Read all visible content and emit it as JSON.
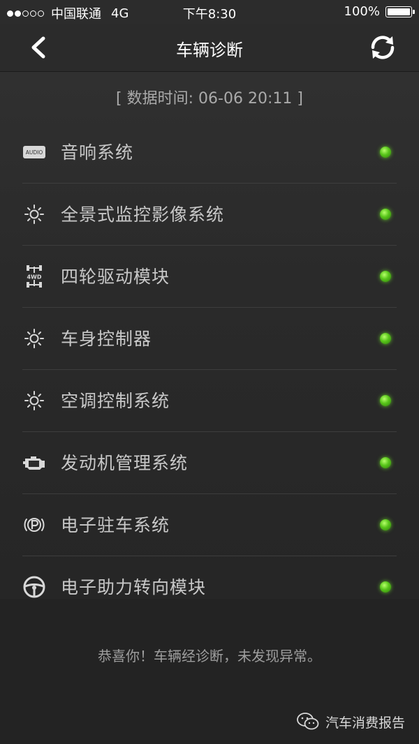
{
  "status_bar": {
    "carrier": "中国联通",
    "network": "4G",
    "time": "下午8:30",
    "battery": "100%",
    "battery_level": 1.0
  },
  "nav": {
    "title": "车辆诊断",
    "back_icon": "chevron-left-icon",
    "refresh_icon": "refresh-icon"
  },
  "data_time": "[ 数据时间: 06-06 20:11 ]",
  "systems": [
    {
      "label": "音响系统",
      "icon": "audio-icon",
      "status_color": "#58c51a"
    },
    {
      "label": "全景式监控影像系统",
      "icon": "sun-icon",
      "status_color": "#58c51a"
    },
    {
      "label": "四轮驱动模块",
      "icon": "4wd-icon",
      "status_color": "#58c51a"
    },
    {
      "label": "车身控制器",
      "icon": "sun-icon",
      "status_color": "#58c51a"
    },
    {
      "label": "空调控制系统",
      "icon": "sun-icon",
      "status_color": "#58c51a"
    },
    {
      "label": "发动机管理系统",
      "icon": "engine-icon",
      "status_color": "#58c51a"
    },
    {
      "label": "电子驻车系统",
      "icon": "parking-brake-icon",
      "status_color": "#58c51a"
    },
    {
      "label": "电子助力转向模块",
      "icon": "steering-wheel-icon",
      "status_color": "#58c51a"
    }
  ],
  "footer": {
    "message": "恭喜你！车辆经诊断，未发现异常。",
    "watermark": "汽车消费报告"
  },
  "audio_icon_text": "AUDIO",
  "fwd_icon_text": "4WD"
}
